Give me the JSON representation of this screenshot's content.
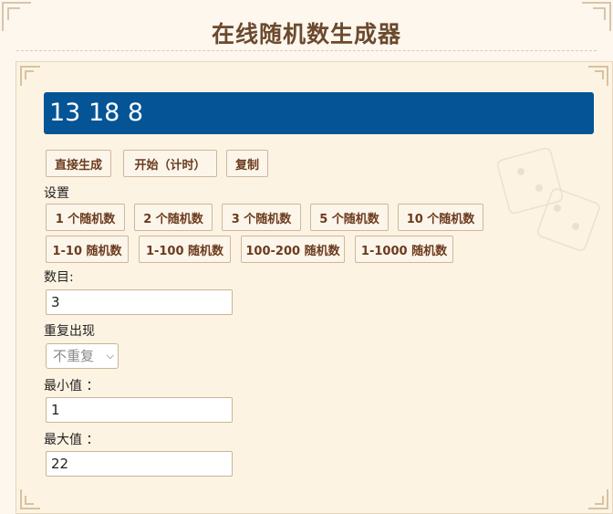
{
  "page": {
    "title": "在线随机数生成器"
  },
  "result": {
    "value": "13 18 8"
  },
  "actions": {
    "generate": "直接生成",
    "start_timed": "开始（计时）",
    "copy": "复制"
  },
  "settings": {
    "heading": "设置",
    "count_presets": [
      "1 个随机数",
      "2 个随机数",
      "3 个随机数",
      "5 个随机数",
      "10 个随机数"
    ],
    "range_presets": [
      "1-10 随机数",
      "1-100 随机数",
      "100-200 随机数",
      "1-1000 随机数"
    ]
  },
  "form": {
    "count_label": "数目:",
    "count_value": "3",
    "repeat_label": "重复出现",
    "repeat_selected": "不重复",
    "min_label": "最小值 ：",
    "min_value": "1",
    "max_label": "最大值 ：",
    "max_value": "22"
  },
  "icons": {
    "select_arrow": "chevron-down-icon"
  }
}
